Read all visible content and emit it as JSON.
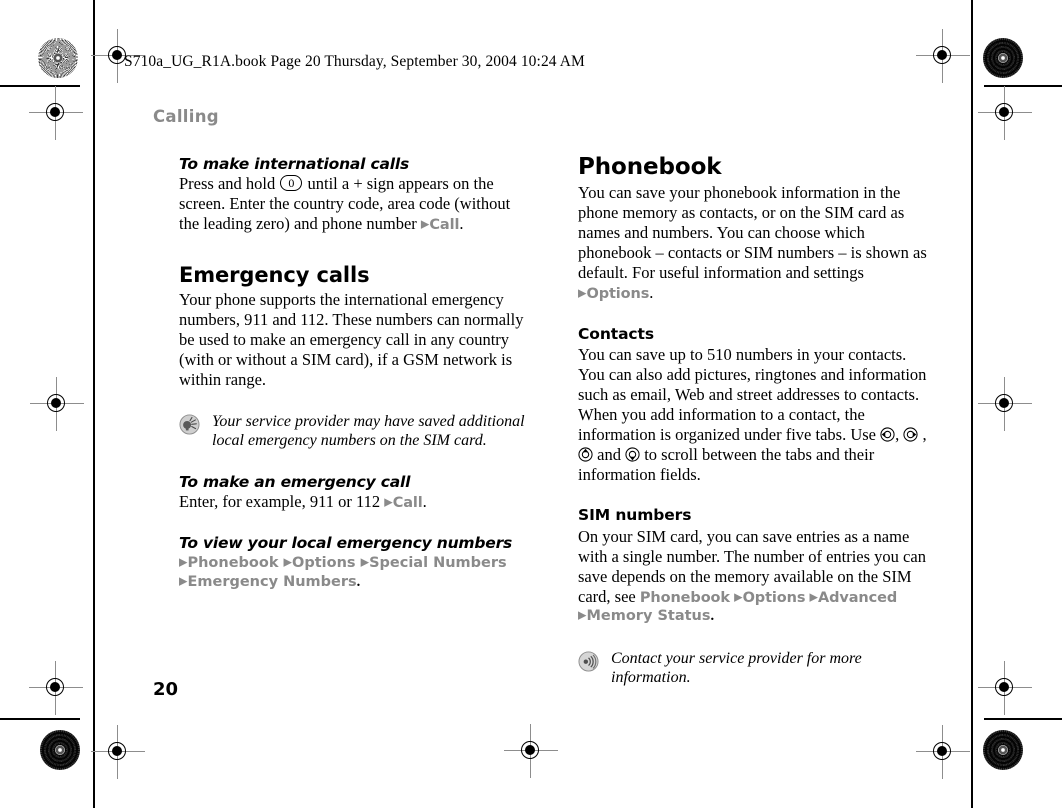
{
  "print_header": "S710a_UG_R1A.book  Page 20  Thursday, September 30, 2004  10:24 AM",
  "running_head": "Calling",
  "folio": "20",
  "colors": {
    "menu_gray": "#8a8a8a",
    "running_head_gray": "#8a8a8a",
    "body_black": "#000000"
  },
  "left_column": {
    "proc_international": {
      "heading": "To make international calls",
      "text_before_key": "Press and hold ",
      "key_label": "0",
      "text_after_key": " until a + sign appears on the screen. Enter the country code, area code (without the leading zero) and phone number ",
      "menu_tail": "Call",
      "period": "."
    },
    "emergency_calls": {
      "heading": "Emergency calls",
      "body": "Your phone supports the international emergency numbers, 911 and 112. These numbers can normally be used to make an emergency call in any country (with or without a SIM card), if a GSM network is within range."
    },
    "tip_note": {
      "icon": "tip-bulb-icon",
      "text": "Your service provider may have saved additional local emergency numbers on the SIM card."
    },
    "proc_emergency_call": {
      "heading": "To make an emergency call",
      "text": "Enter, for example, 911 or 112 ",
      "menu_tail": "Call",
      "period": "."
    },
    "proc_view_emergency_numbers": {
      "heading": "To view your local emergency numbers",
      "path_line_1": [
        "Phonebook",
        "Options",
        "Special Numbers"
      ],
      "path_line_2": [
        "Emergency Numbers"
      ],
      "period": "."
    }
  },
  "right_column": {
    "phonebook": {
      "heading": "Phonebook",
      "body": "You can save your phonebook information in the phone memory as contacts, or on the SIM card as names and numbers. You can choose which phonebook – contacts or SIM numbers – is shown as default. For useful information and settings ",
      "menu_tail": "Options",
      "period": "."
    },
    "contacts": {
      "heading": "Contacts",
      "body_part_1": "You can save up to 510 numbers in your contacts. You can also add pictures, ringtones and information such as email, Web and street addresses to contacts. When you add information to a contact, the information is organized under five tabs. Use ",
      "nav_icons": [
        "nav-left-icon",
        "nav-right-icon",
        "nav-up-icon",
        "nav-down-icon"
      ],
      "sep_1": ", ",
      "sep_2": " , ",
      "sep_3": " and ",
      "body_part_2": " to scroll between the tabs and their information fields."
    },
    "sim_numbers": {
      "heading": "SIM numbers",
      "body": "On your SIM card, you can save entries as a name with a single number. The number of entries you can save depends on the memory available on the SIM card, see ",
      "path_line_1": [
        "Phonebook",
        "Options",
        "Advanced"
      ],
      "path_line_2": [
        "Memory Status"
      ],
      "period": "."
    },
    "info_note": {
      "icon": "note-signal-icon",
      "text": "Contact your service provider for more information."
    }
  },
  "print_marks": {
    "registration_targets": 7,
    "rosettes": 4,
    "trim_rules": 6
  }
}
